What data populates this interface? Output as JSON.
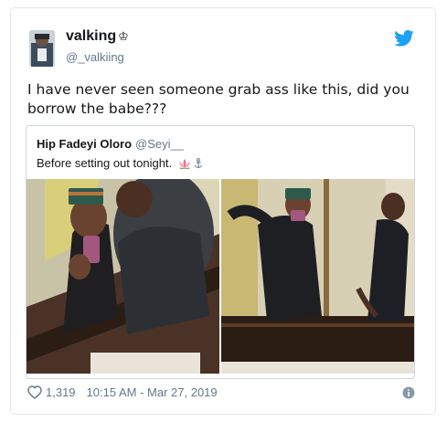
{
  "user": {
    "display_name": "valking",
    "handle": "@_valkiing",
    "avatar_icon": "profile-photo"
  },
  "tweet": {
    "text": "I have never seen someone grab ass like this, did you borrow the babe???"
  },
  "quoted_tweet": {
    "display_name": "Hip Fadeyi Oloro",
    "handle": "@Seyi__",
    "text": "Before setting out tonight.",
    "emoji_icons": [
      "lotus-icon",
      "anchor-icon"
    ]
  },
  "footer": {
    "likes": "1,319",
    "timestamp": "10:15 AM - Mar 27, 2019"
  },
  "colors": {
    "twitter_blue": "#1da1f2",
    "secondary_text": "#657786",
    "border": "#e1e8ed"
  }
}
